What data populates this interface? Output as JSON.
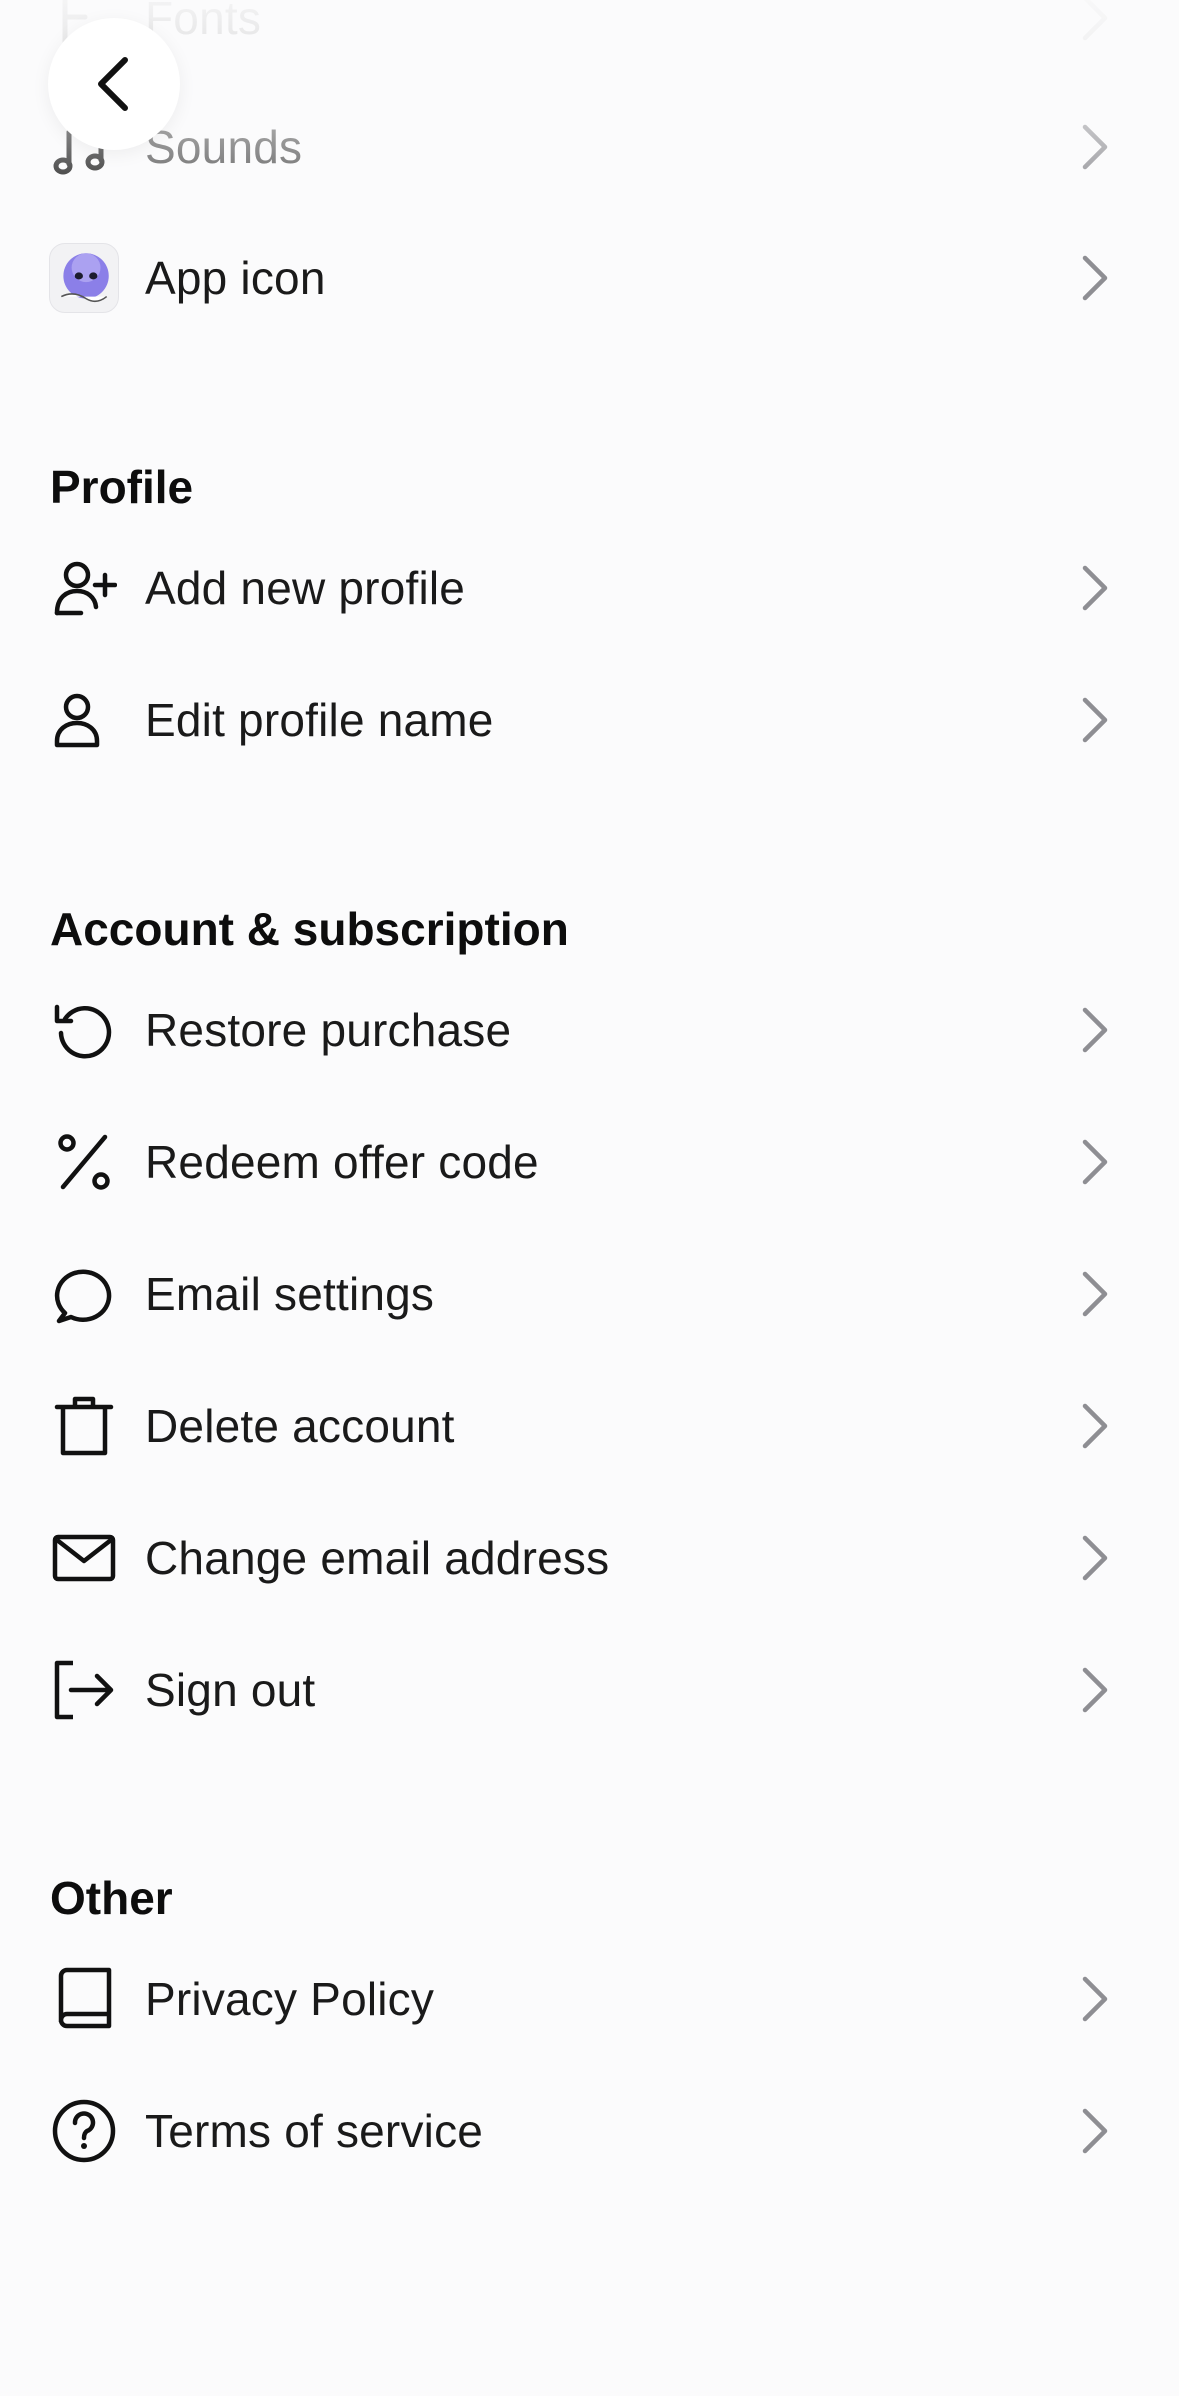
{
  "nav": {
    "back_icon": "chevron-left-icon"
  },
  "appearance": {
    "items": [
      {
        "label": "Fonts",
        "icon": "font-icon"
      },
      {
        "label": "Sounds",
        "icon": "music-note-icon"
      },
      {
        "label": "App icon",
        "icon": "app-icon-thumbnail"
      }
    ]
  },
  "profile": {
    "title": "Profile",
    "items": [
      {
        "label": "Add new profile",
        "icon": "user-plus-icon"
      },
      {
        "label": "Edit profile name",
        "icon": "user-icon"
      }
    ]
  },
  "account": {
    "title": "Account & subscription",
    "items": [
      {
        "label": "Restore purchase",
        "icon": "restore-icon"
      },
      {
        "label": "Redeem offer code",
        "icon": "percent-icon"
      },
      {
        "label": "Email settings",
        "icon": "chat-bubble-icon"
      },
      {
        "label": "Delete account",
        "icon": "trash-icon"
      },
      {
        "label": "Change email address",
        "icon": "envelope-icon"
      },
      {
        "label": "Sign out",
        "icon": "sign-out-icon"
      }
    ]
  },
  "other": {
    "title": "Other",
    "items": [
      {
        "label": "Privacy Policy",
        "icon": "book-icon"
      },
      {
        "label": "Terms of service",
        "icon": "question-circle-icon"
      }
    ]
  },
  "colors": {
    "background": "#fbfbfc",
    "text": "#1a1a1a",
    "chevron": "#8e8e93",
    "app_icon_purple": "#8b7fe8"
  }
}
